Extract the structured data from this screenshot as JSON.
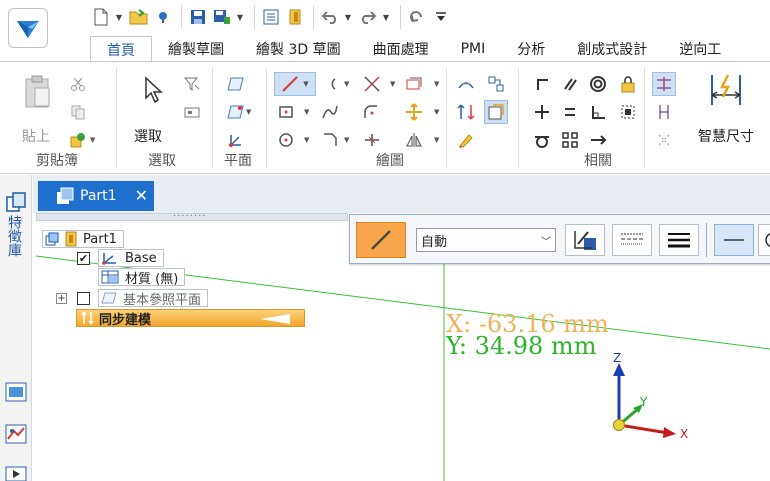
{
  "qat": {
    "icons": [
      "new-file-icon",
      "open-folder-icon",
      "pin-icon",
      "save-icon",
      "save-as-icon",
      "properties-icon",
      "export-icon",
      "undo-icon",
      "redo-icon",
      "repeat-icon",
      "customize-icon"
    ]
  },
  "tabs": [
    {
      "label": "首頁",
      "active": true
    },
    {
      "label": "繪製草圖"
    },
    {
      "label": "繪製 3D 草圖"
    },
    {
      "label": "曲面處理"
    },
    {
      "label": "PMI"
    },
    {
      "label": "分析"
    },
    {
      "label": "創成式設計"
    },
    {
      "label": "逆向工"
    }
  ],
  "ribbon": {
    "groups": {
      "clipboard": "剪貼簿",
      "select": "選取",
      "plane": "平面",
      "draw": "繪圖",
      "relate": "相關"
    },
    "paste_label": "貼上",
    "select_label": "選取",
    "smart_dimension_label": "智慧尺寸"
  },
  "left_strip": {
    "feature_library": "特徵庫"
  },
  "document": {
    "tab_title": "Part1",
    "close_glyph": "✕"
  },
  "tree": {
    "root": "Part1",
    "base": "Base",
    "material": "材質 (無)",
    "ref_planes": "基本參照平面",
    "sync": "同步建模",
    "grip": "........"
  },
  "command_bar": {
    "mode_value": "自動",
    "mode_options": [
      "自動"
    ]
  },
  "canvas": {
    "x_readout": "X: -63.16 mm",
    "y_readout": "Y: 34.98 mm",
    "axis_z": "Z",
    "axis_y": "Y",
    "axis_x": "X"
  },
  "colors": {
    "accent_blue": "#1f6fcf",
    "sync_orange": "#f2a62c",
    "line_green": "#2cb52c",
    "x_readout": "#f0b25a"
  }
}
